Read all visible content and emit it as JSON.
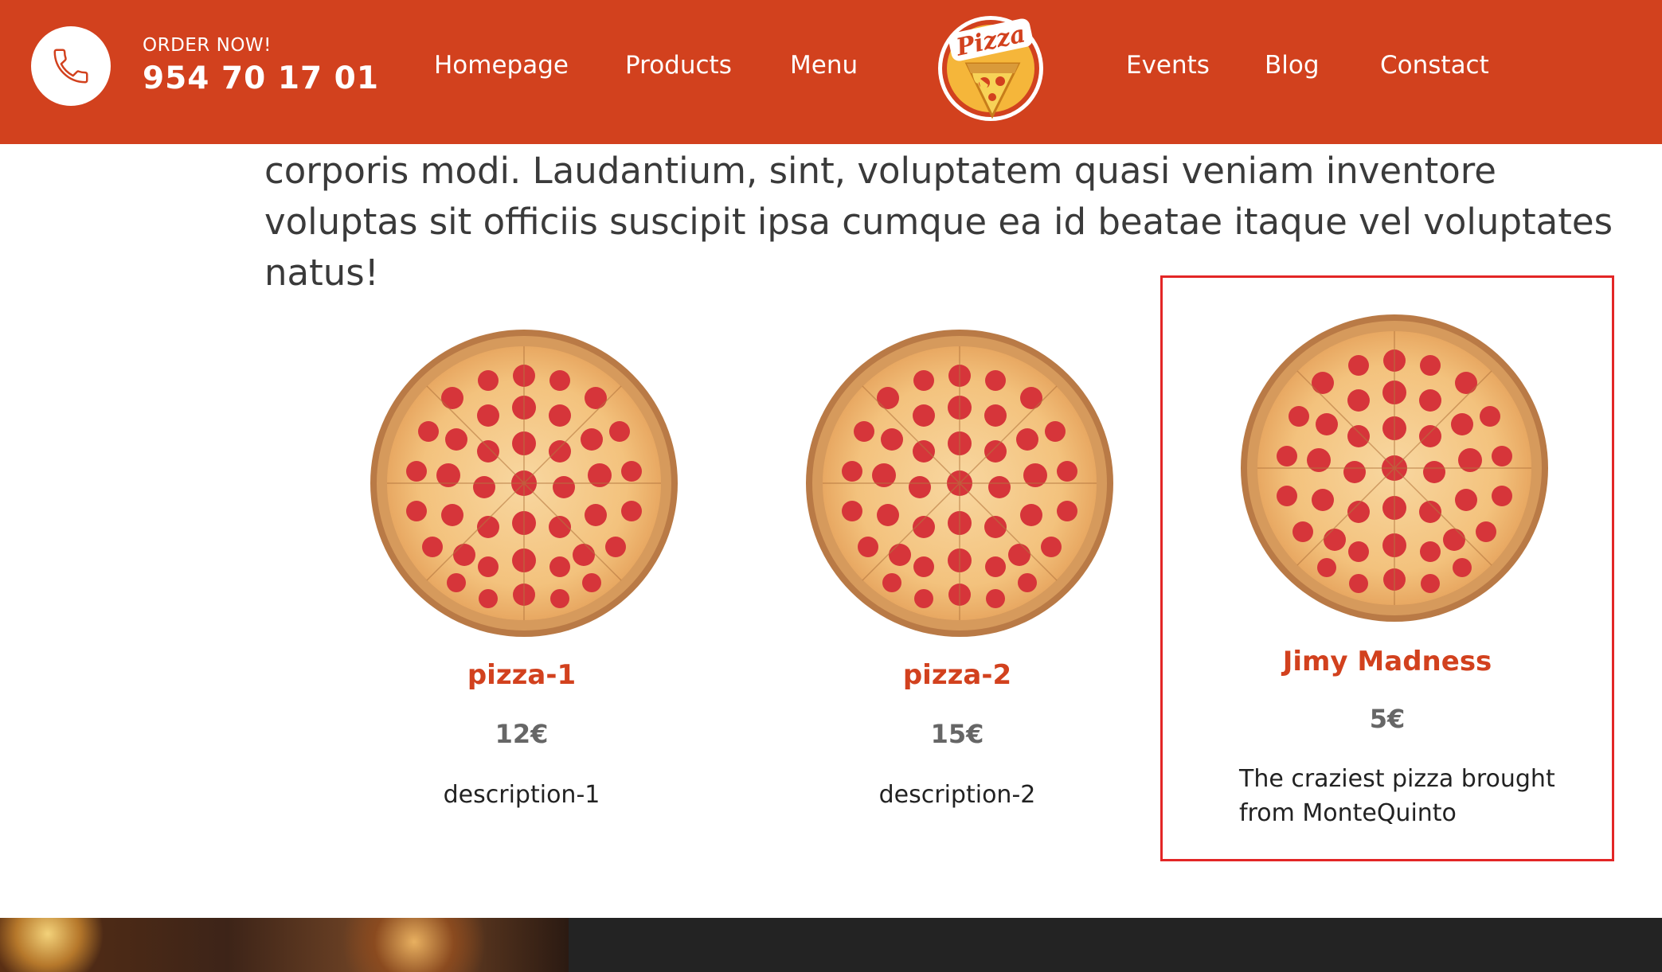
{
  "header": {
    "order_label": "ORDER NOW!",
    "order_number": "954 70 17 01",
    "nav_left": [
      "Homepage",
      "Products",
      "Menu"
    ],
    "nav_right": [
      "Events",
      "Blog",
      "Constact"
    ],
    "logo_text": "Pizza",
    "background_color": "#d2411e",
    "phone_icon": "phone-icon"
  },
  "intro": {
    "text": "corporis modi. Laudantium, sint, voluptatem quasi veniam inventore voluptas sit officiis suscipit ipsa cumque ea id beatae itaque vel voluptates natus!"
  },
  "products": [
    {
      "title": "pizza-1",
      "price": "12€",
      "description": "description-1"
    },
    {
      "title": "pizza-2",
      "price": "15€",
      "description": "description-2"
    },
    {
      "title": "Jimy Madness",
      "price": "5€",
      "description": "The craziest pizza brought from MonteQuinto"
    }
  ],
  "colors": {
    "accent": "#d2411e",
    "selected_border": "#e32626",
    "footer_dark": "#232323"
  }
}
